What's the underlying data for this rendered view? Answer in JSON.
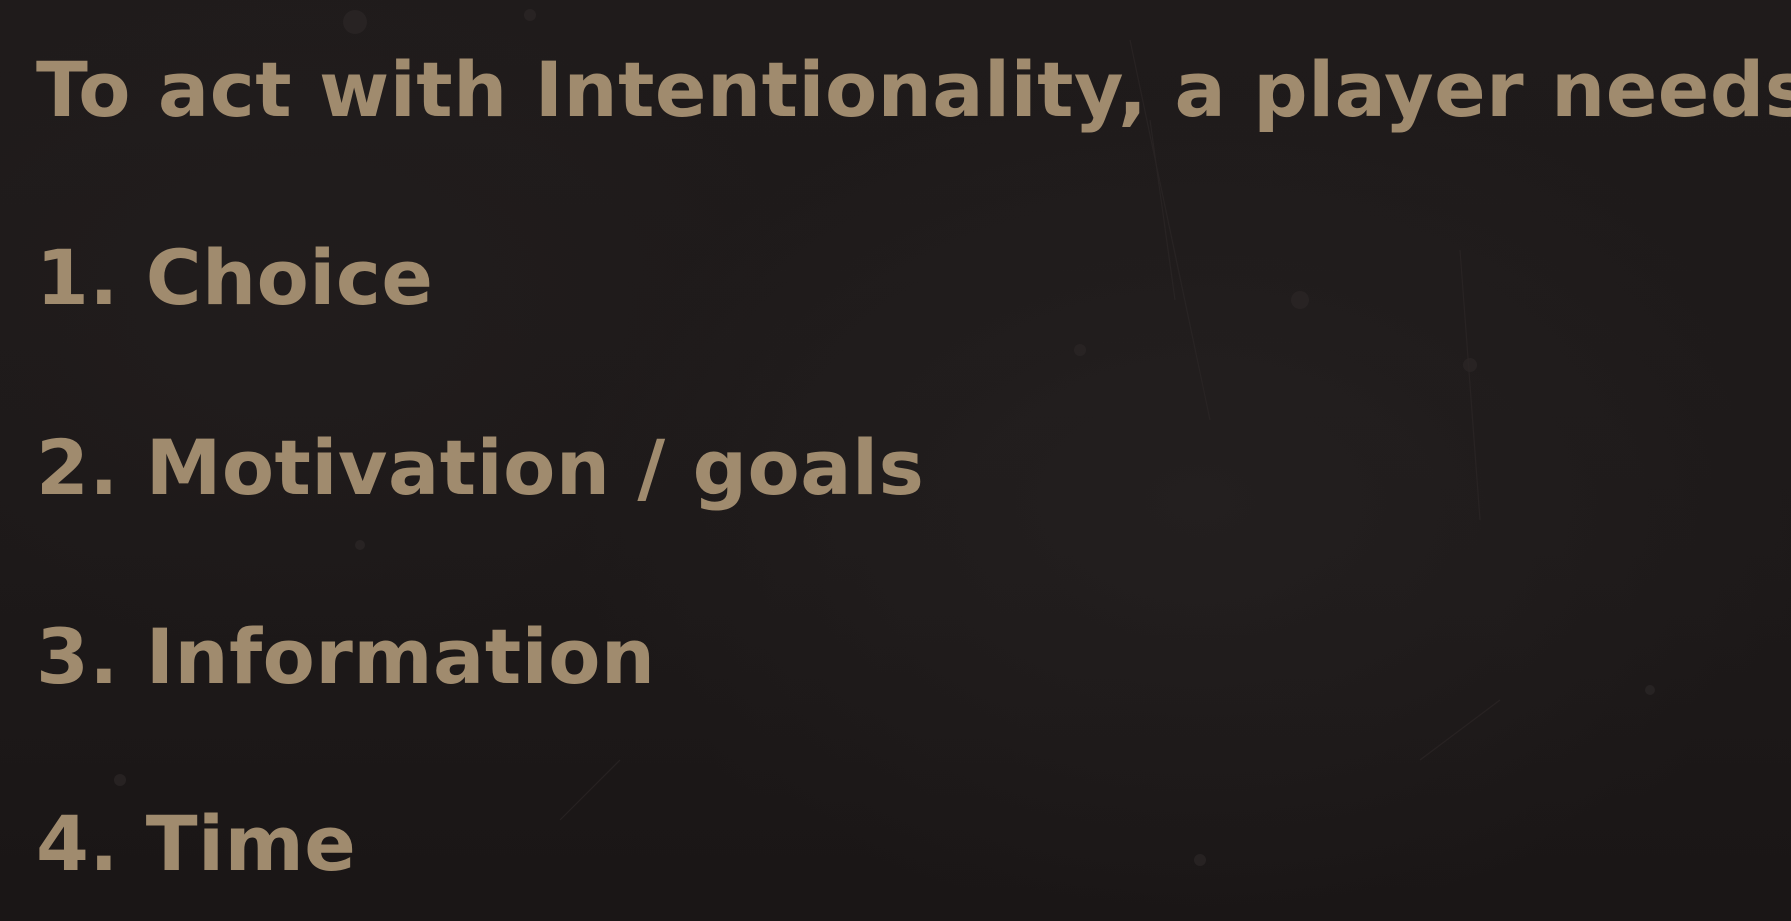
{
  "slide": {
    "heading": "To act with Intentionality, a player needs:",
    "items": [
      "1. Choice",
      "2. Motivation / goals",
      "3. Information",
      "4. Time"
    ]
  },
  "colors": {
    "background": "#1e1a1a",
    "text": "#a08b6e"
  }
}
